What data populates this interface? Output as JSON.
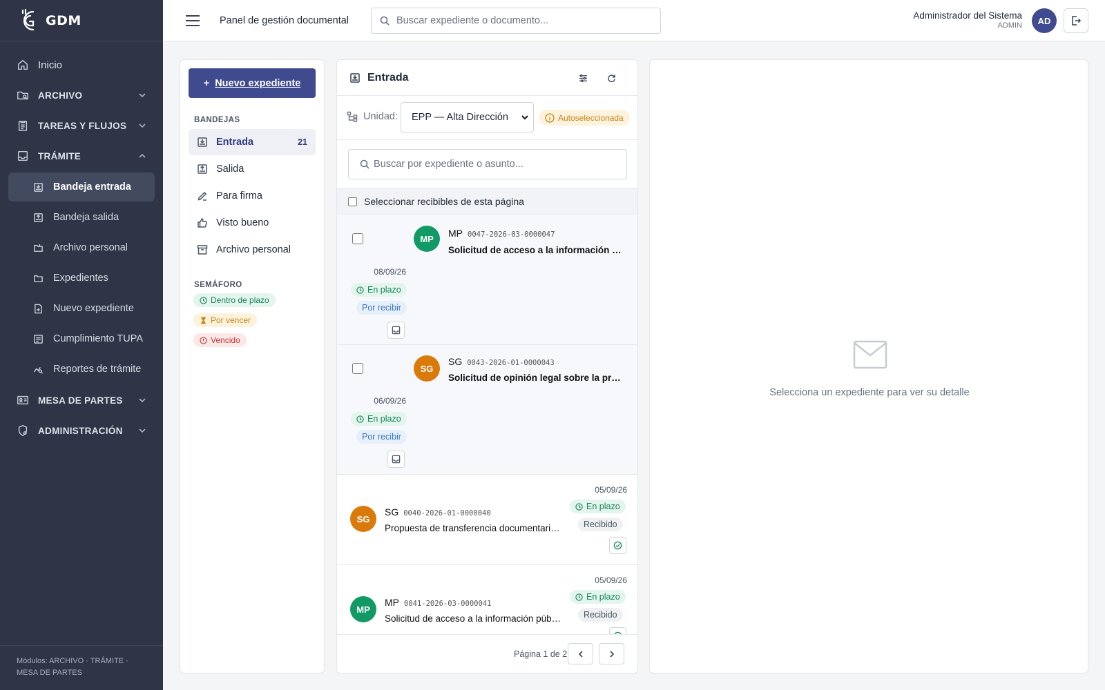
{
  "brand": {
    "name": "GDM"
  },
  "sidebar": {
    "items": [
      {
        "label": "Inicio"
      },
      {
        "label": "ARCHIVO"
      },
      {
        "label": "TAREAS Y FLUJOS"
      },
      {
        "label": "TRÁMITE"
      }
    ],
    "tramite_sub": [
      {
        "label": "Bandeja entrada"
      },
      {
        "label": "Bandeja salida"
      },
      {
        "label": "Archivo personal"
      },
      {
        "label": "Expedientes"
      },
      {
        "label": "Nuevo expediente"
      },
      {
        "label": "Cumplimiento TUPA"
      },
      {
        "label": "Reportes de trámite"
      }
    ],
    "bottom_items": [
      {
        "label": "MESA DE PARTES"
      },
      {
        "label": "ADMINISTRACIÓN"
      }
    ],
    "footer": "Módulos: ARCHIVO · TRÁMITE · MESA DE PARTES"
  },
  "topbar": {
    "title": "Panel de gestión documental",
    "search_placeholder": "Buscar expediente o documento...",
    "user_name": "Administrador del Sistema",
    "user_role": "ADMIN",
    "avatar": "AD"
  },
  "left_panel": {
    "new_button": "Nuevo expediente",
    "new_button_icon": "+",
    "trays_label": "BANDEJAS",
    "trays": [
      {
        "label": "Entrada",
        "count": "21"
      },
      {
        "label": "Salida"
      },
      {
        "label": "Para firma"
      },
      {
        "label": "Visto bueno"
      },
      {
        "label": "Archivo personal"
      }
    ],
    "semaforo_label": "SEMÁFORO",
    "semaforo": [
      {
        "label": "Dentro de plazo",
        "color": "#17865a",
        "bg": "#e3f5ec"
      },
      {
        "label": "Por vencer",
        "color": "#c8841a",
        "bg": "#fdf3dd"
      },
      {
        "label": "Vencido",
        "color": "#c43a3a",
        "bg": "#fde8e8"
      }
    ]
  },
  "inbox": {
    "title": "Entrada",
    "unit_label": "Unidad:",
    "unit_value": "EPP — Alta Dirección",
    "auto_badge": "Autoseleccionada",
    "search_placeholder": "Buscar por expediente o asunto...",
    "select_all": "Seleccionar recibibles de esta página",
    "items": [
      {
        "initials": "MP",
        "org": "MP",
        "code": "0047-2026-03-0000047",
        "subject": "Solicitud de acceso a la información pública",
        "date": "08/09/26",
        "deadline": "En plazo",
        "status": "Por recibir"
      },
      {
        "initials": "SG",
        "org": "SG",
        "code": "0043-2026-01-0000043",
        "subject": "Solicitud de opinión legal sobre la procedencia",
        "date": "06/09/26",
        "deadline": "En plazo",
        "status": "Por recibir"
      },
      {
        "initials": "SG",
        "org": "SG",
        "code": "0040-2026-01-0000040",
        "subject": "Propuesta de transferencia documentaria a...",
        "date": "05/09/26",
        "deadline": "En plazo",
        "status": "Recibido"
      },
      {
        "initials": "MP",
        "org": "MP",
        "code": "0041-2026-03-0000041",
        "subject": "Solicitud de acceso a la información públic...",
        "date": "05/09/26",
        "deadline": "En plazo",
        "status": "Recibido"
      }
    ],
    "pager": "Página 1 de 2"
  },
  "detail": {
    "empty": "Selecciona un expediente para ver su detalle"
  },
  "colors": {
    "sidebar_bg": "#2f3446",
    "primary": "#3f4a8f",
    "green": "#129a66",
    "orange": "#d97a0b"
  }
}
